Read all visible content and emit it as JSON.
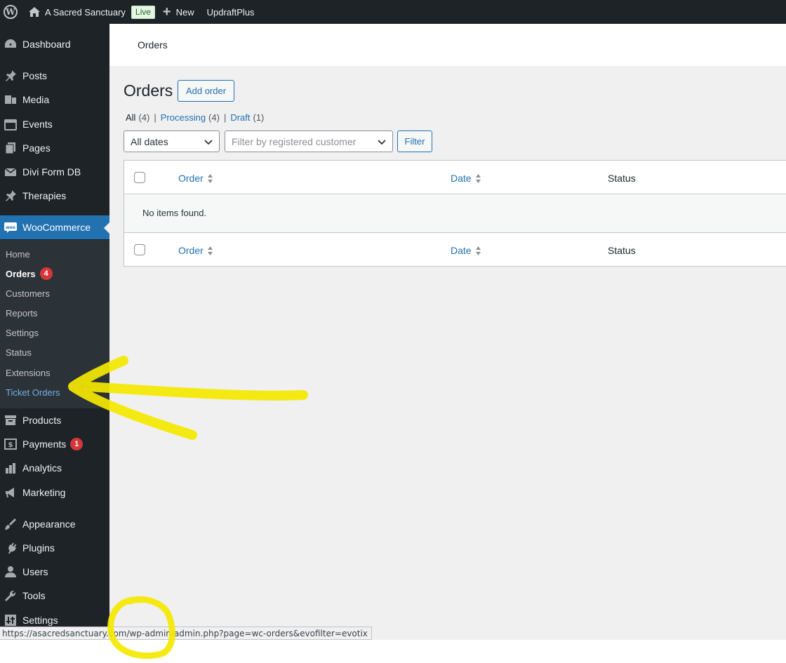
{
  "adminbar": {
    "site_name": "A Sacred Sanctuary",
    "live_badge": "Live",
    "new_label": "New",
    "updraft_label": "UpdraftPlus"
  },
  "sidebar": {
    "items": [
      {
        "label": "Dashboard",
        "icon": "dashboard-icon"
      },
      {
        "label": "Posts",
        "icon": "pin-icon"
      },
      {
        "label": "Media",
        "icon": "media-icon"
      },
      {
        "label": "Events",
        "icon": "calendar-icon"
      },
      {
        "label": "Pages",
        "icon": "pages-icon"
      },
      {
        "label": "Divi Form DB",
        "icon": "email-icon"
      },
      {
        "label": "Therapies",
        "icon": "pin-icon"
      },
      {
        "label": "WooCommerce",
        "icon": "woo-icon"
      },
      {
        "label": "Products",
        "icon": "archive-icon"
      },
      {
        "label": "Payments",
        "icon": "dollar-icon",
        "badge": "1"
      },
      {
        "label": "Analytics",
        "icon": "bar-chart-icon"
      },
      {
        "label": "Marketing",
        "icon": "megaphone-icon"
      },
      {
        "label": "Appearance",
        "icon": "brush-icon"
      },
      {
        "label": "Plugins",
        "icon": "plugin-icon"
      },
      {
        "label": "Users",
        "icon": "user-icon"
      },
      {
        "label": "Tools",
        "icon": "wrench-icon"
      },
      {
        "label": "Settings",
        "icon": "settings-icon"
      }
    ],
    "woo_submenu": [
      {
        "label": "Home"
      },
      {
        "label": "Orders",
        "badge": "4"
      },
      {
        "label": "Customers"
      },
      {
        "label": "Reports"
      },
      {
        "label": "Settings"
      },
      {
        "label": "Status"
      },
      {
        "label": "Extensions"
      },
      {
        "label": "Ticket Orders"
      }
    ]
  },
  "header": {
    "breadcrumb": "Orders"
  },
  "main": {
    "title": "Orders",
    "add_order_label": "Add order",
    "views": [
      {
        "label": "All",
        "count": "(4)"
      },
      {
        "label": "Processing",
        "count": "(4)"
      },
      {
        "label": "Draft",
        "count": "(1)"
      }
    ],
    "separator": "|",
    "date_filter": "All dates",
    "customer_filter_placeholder": "Filter by registered customer",
    "filter_label": "Filter",
    "columns": {
      "order": "Order",
      "date": "Date",
      "status": "Status"
    },
    "empty_message": "No items found."
  },
  "statusbar": {
    "url": "https://asacredsanctuary.com/wp-admin/admin.php?page=wc-orders&evofilter=evotix"
  },
  "colors": {
    "admin_dark": "#1d2327",
    "accent_blue": "#2271b1",
    "badge_red": "#d63638",
    "annotation_yellow": "#f5e800"
  }
}
